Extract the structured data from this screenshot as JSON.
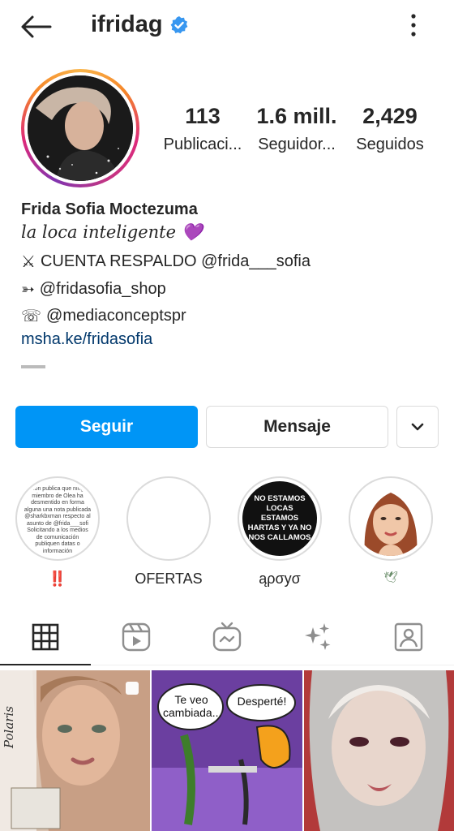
{
  "header": {
    "username": "ifridag",
    "verified_icon": "verified-badge-icon",
    "back_icon": "arrow-left-icon",
    "more_icon": "more-vertical-icon"
  },
  "stats": [
    {
      "value": "113",
      "label": "Publicaci..."
    },
    {
      "value": "1.6 mill.",
      "label": "Seguidor..."
    },
    {
      "value": "2,429",
      "label": "Seguidos"
    }
  ],
  "bio": {
    "name": "Frida Sofia Moctezuma",
    "tagline": "la loca inteligente",
    "tagline_emoji": "💜",
    "line1_icon": "⚔",
    "line1": "CUENTA RESPALDO @frida___sofia",
    "line2_icon": "➳",
    "line2": "@fridasofia_shop",
    "line3_icon": "☏",
    "line3": "@mediaconceptspr",
    "link": "msha.ke/fridasofia"
  },
  "actions": {
    "follow": "Seguir",
    "message": "Mensaje",
    "more_icon": "chevron-down-icon"
  },
  "highlights": [
    {
      "label": "‼️",
      "text": "...mon publica que ningún miembro de Olea ha desmentido en forma alguna una nota publicada @sharkbxman respecto al asunto de @frida___sofi Solicitando a los medios de comunicación publiquen datas o información"
    },
    {
      "label": "OFERTAS",
      "text": ""
    },
    {
      "label": "ąρσyσ",
      "text": "NO ESTAMOS LOCAS ESTAMOS HARTAS Y YA NO NOS CALLAMOS"
    },
    {
      "label": "🕊",
      "text": ""
    }
  ],
  "tabs": [
    "grid-icon",
    "reels-icon",
    "igtv-icon",
    "effects-icon",
    "tagged-icon"
  ],
  "posts": [
    {
      "caption": "Polaris"
    },
    {
      "bubble1": "Te veo cambiada...",
      "bubble2": "Desperté!"
    },
    {
      "caption": ""
    }
  ],
  "colors": {
    "accent": "#0095f6",
    "link": "#00376b",
    "verified": "#3897f0"
  }
}
